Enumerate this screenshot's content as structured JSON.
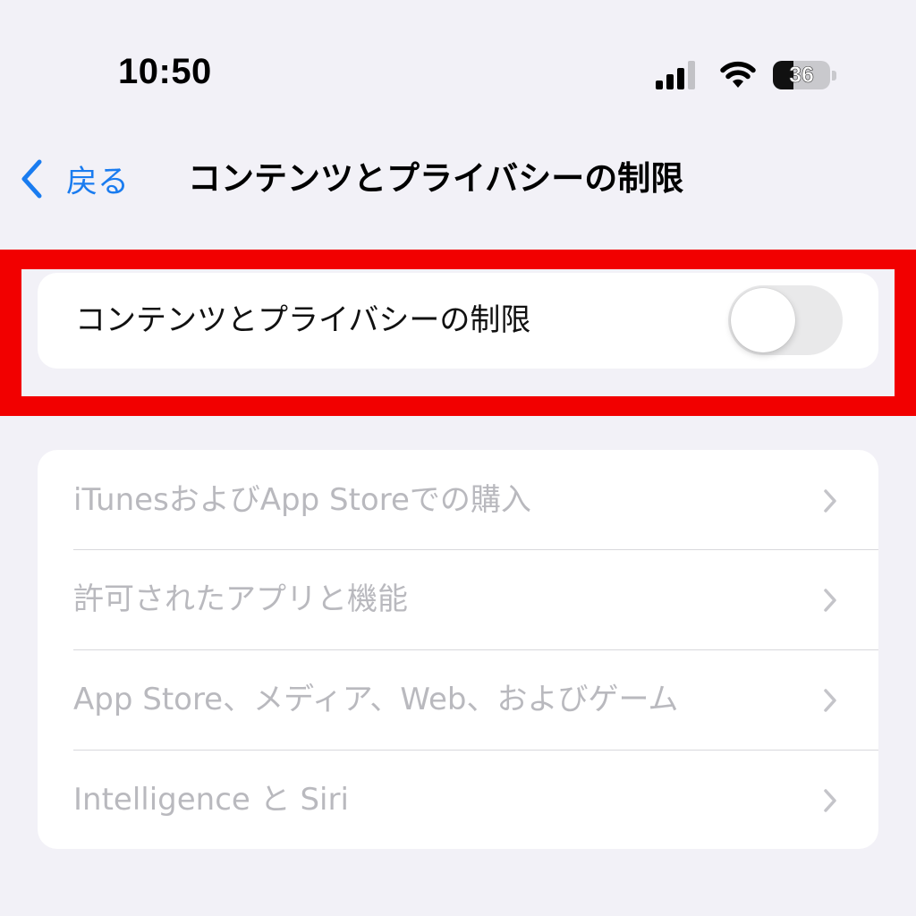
{
  "status_bar": {
    "time": "10:50",
    "signal_icon": "cellular-signal-icon",
    "wifi_icon": "wifi-icon",
    "battery_level": "36",
    "battery_fraction": 0.36
  },
  "nav": {
    "back_label": "戻る",
    "back_icon": "chevron-left-icon",
    "title": "コンテンツとプライバシーの制限",
    "accent_color": "#1a7cf0"
  },
  "highlight": {
    "color": "#f20000"
  },
  "toggle_row": {
    "label": "コンテンツとプライバシーの制限",
    "state": "off"
  },
  "menu": {
    "items": [
      {
        "label": "iTunesおよびApp Storeでの購入",
        "icon": "chevron-right-icon",
        "enabled": false
      },
      {
        "label": "許可されたアプリと機能",
        "icon": "chevron-right-icon",
        "enabled": false
      },
      {
        "label": "App Store、メディア、Web、およびゲーム",
        "icon": "chevron-right-icon",
        "enabled": false
      },
      {
        "label": "Intelligence と Siri",
        "icon": "chevron-right-icon",
        "enabled": false
      }
    ],
    "disabled_text_color": "#b9b9be"
  },
  "colors": {
    "background": "#f2f1f7",
    "card": "#ffffff"
  }
}
